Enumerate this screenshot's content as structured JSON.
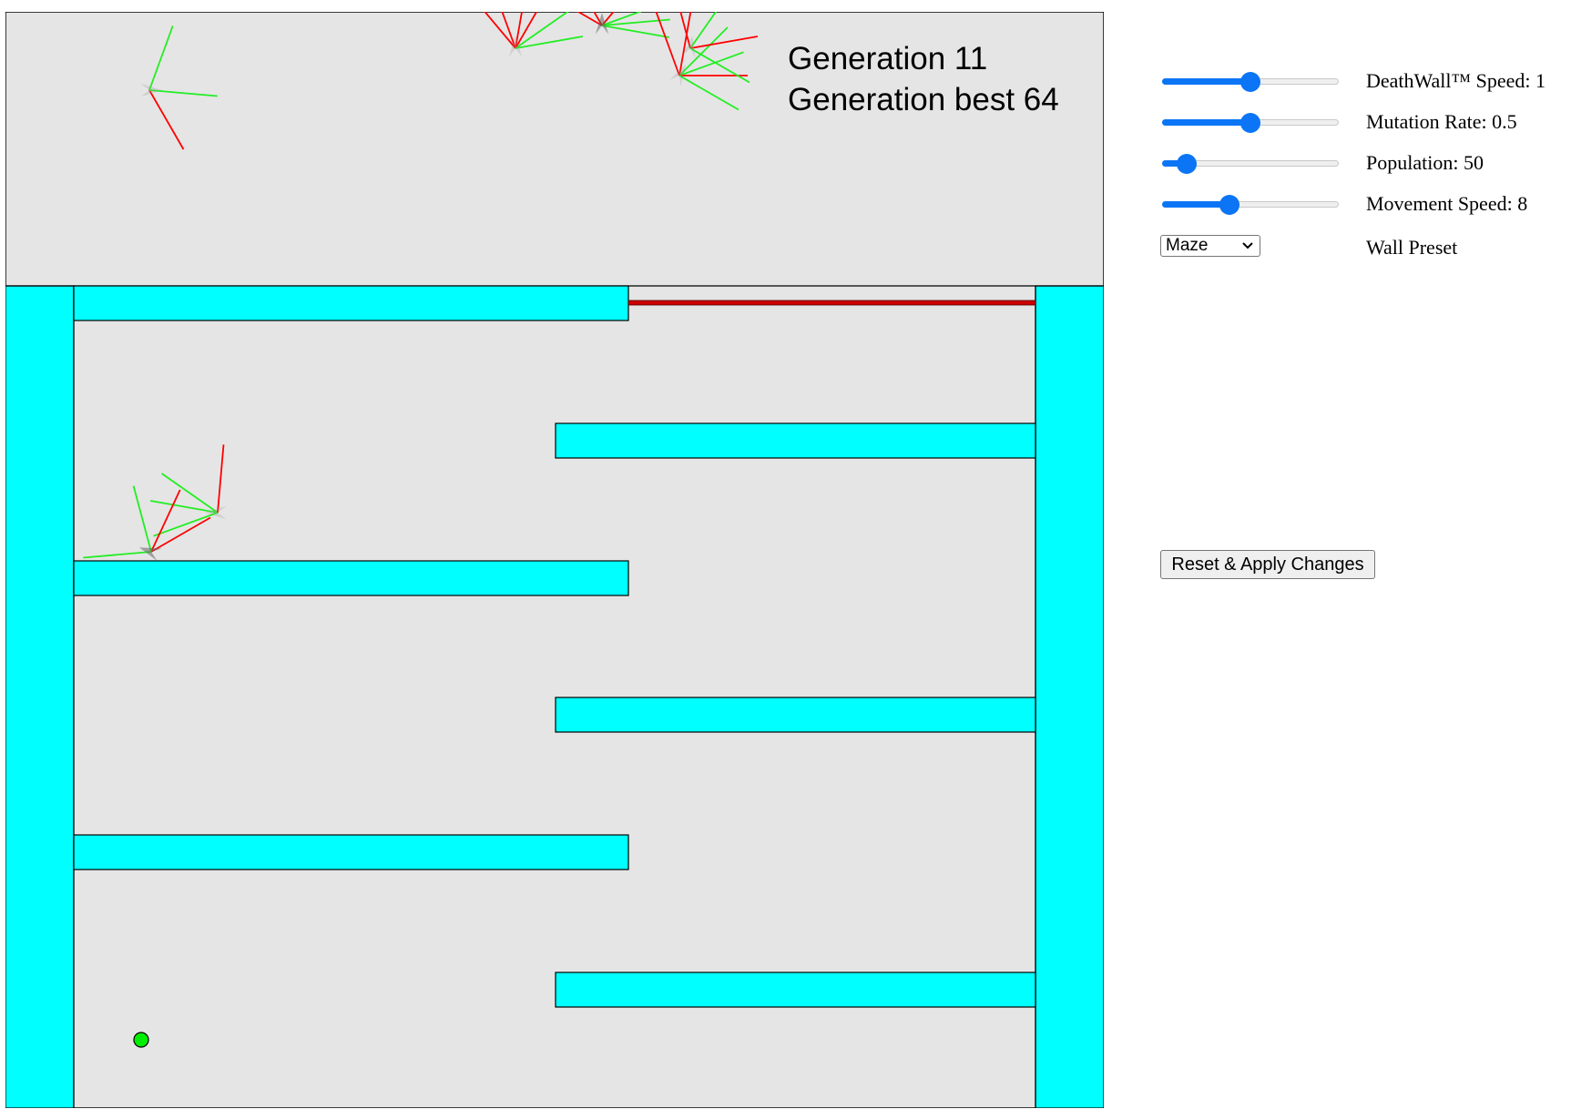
{
  "simulation": {
    "generation_label": "Generation 11",
    "best_label": "Generation best 64",
    "colors": {
      "background": "#e5e5e5",
      "wall": "#00ffff",
      "death_wall": "#cc0000",
      "ray_hit": "#ff0000",
      "ray_clear": "#22ee22",
      "goal": "#00ee00"
    }
  },
  "controls": {
    "sliders": [
      {
        "id": "deathwall-speed",
        "label": "DeathWall™ Speed: 1",
        "value": 1,
        "fraction": 0.5
      },
      {
        "id": "mutation-rate",
        "label": "Mutation Rate: 0.5",
        "value": 0.5,
        "fraction": 0.5
      },
      {
        "id": "population",
        "label": "Population: 50",
        "value": 50,
        "fraction": 0.14
      },
      {
        "id": "movement-speed",
        "label": "Movement Speed: 8",
        "value": 8,
        "fraction": 0.38
      }
    ],
    "wall_preset": {
      "selected": "Maze",
      "label": "Wall Preset"
    },
    "reset_button": "Reset & Apply Changes"
  }
}
